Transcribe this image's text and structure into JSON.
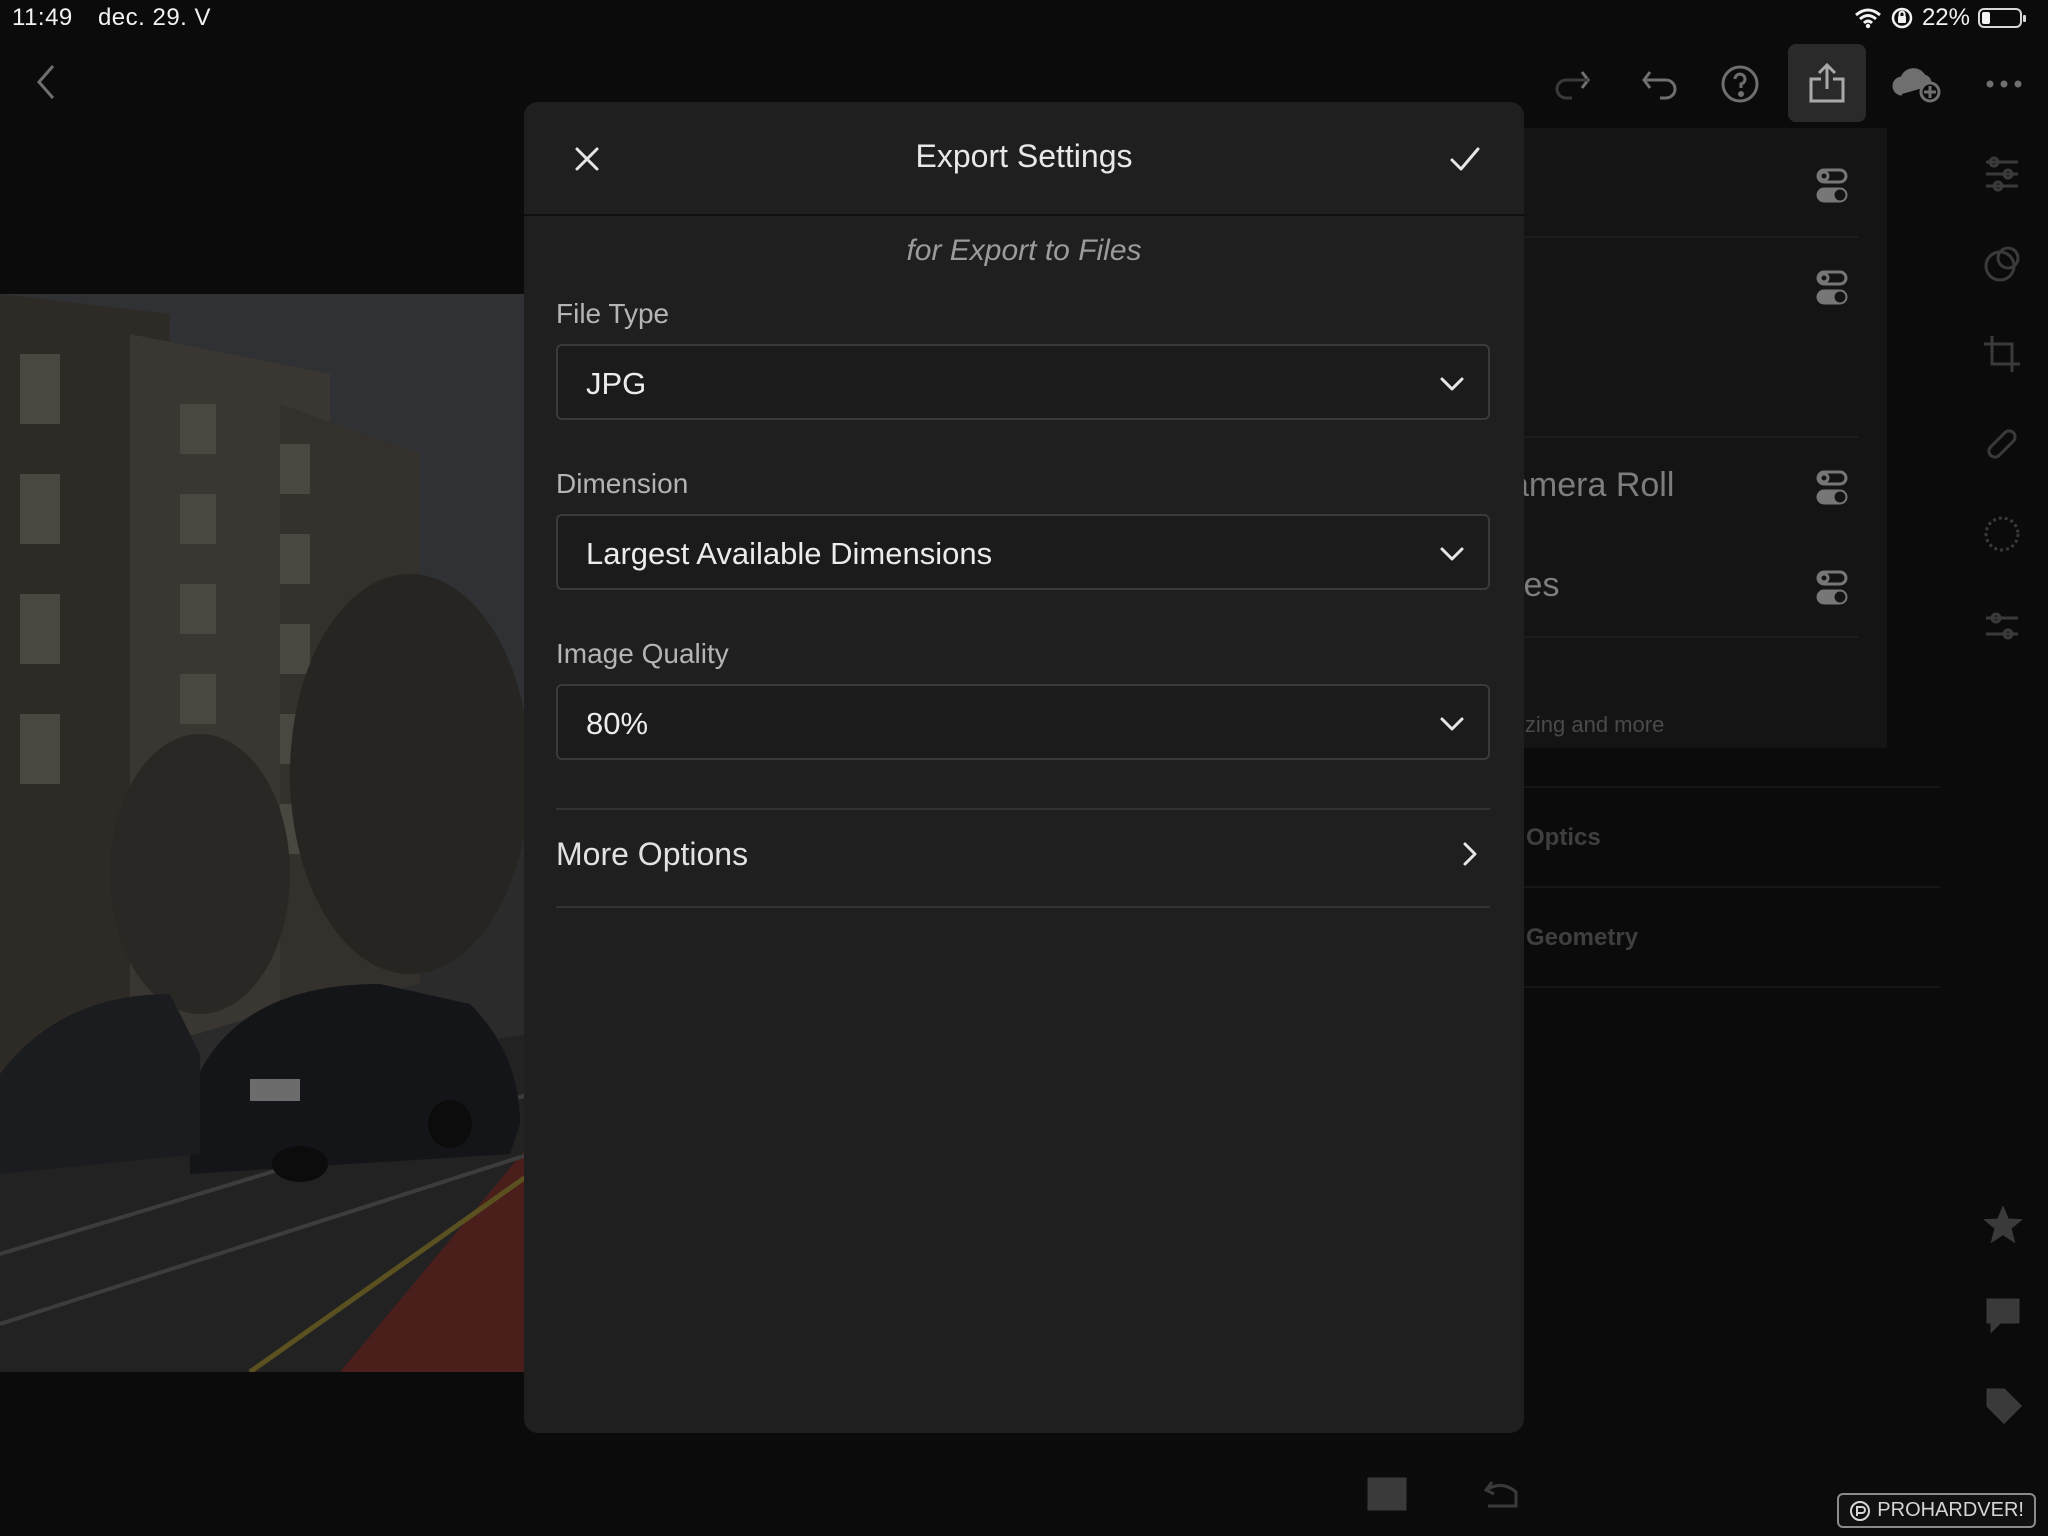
{
  "status_bar": {
    "time": "11:49",
    "date": "dec. 29. V",
    "battery": "22%",
    "battery_level": 0.22,
    "icons": [
      "wifi-icon",
      "rotation-lock-icon",
      "battery-icon"
    ]
  },
  "toolbar": {
    "icons": [
      "back-icon",
      "redo-icon",
      "undo-icon",
      "help-icon",
      "share-icon",
      "cloud-add-icon",
      "more-icon"
    ]
  },
  "background_panel": {
    "rows": [
      {
        "text": "amera Roll"
      },
      {
        "text": "les"
      }
    ],
    "footer_text": "izing and more",
    "sections": [
      "Optics",
      "Geometry"
    ]
  },
  "side_toolbar": {
    "icons": [
      "edit-sliders-icon",
      "masking-icon",
      "crop-icon",
      "healing-icon",
      "selective-icon",
      "presets-icon",
      "star-icon",
      "comment-icon",
      "tag-icon"
    ]
  },
  "bottom_bar": {
    "icons": [
      "compare-icon",
      "reset-icon"
    ]
  },
  "modal": {
    "title": "Export Settings",
    "subtitle": "for Export to Files",
    "fields": {
      "file_type": {
        "label": "File Type",
        "value": "JPG"
      },
      "dimension": {
        "label": "Dimension",
        "value": "Largest Available Dimensions"
      },
      "image_quality": {
        "label": "Image Quality",
        "value": "80%"
      }
    },
    "more_options": "More Options"
  },
  "watermark": "PROHARDVER!",
  "colors": {
    "modal_bg": "#1f1f20",
    "page_bg": "#0b0b0b",
    "text_primary": "#e8e8e8",
    "text_secondary": "#9b9b9b"
  }
}
